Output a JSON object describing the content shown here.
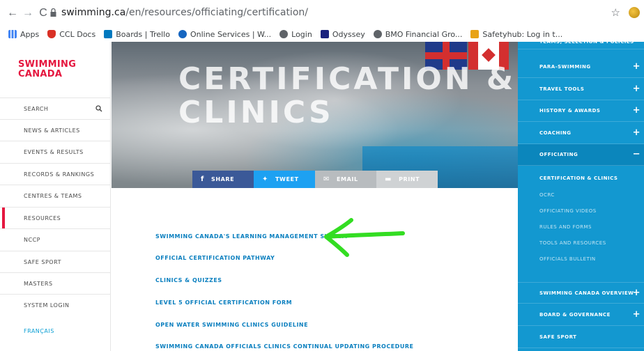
{
  "browser": {
    "url_host": "swimming.ca",
    "url_path": "/en/resources/officiating/certification/",
    "bookmarks": [
      {
        "label": "Apps",
        "icon": "apps-grid-icon",
        "color": "#4285f4"
      },
      {
        "label": "CCL Docs",
        "icon": "ccl-shield-icon",
        "color": "#d93025"
      },
      {
        "label": "Boards | Trello",
        "icon": "trello-icon",
        "color": "#0079bf"
      },
      {
        "label": "Online Services | W...",
        "icon": "online-services-icon",
        "color": "#1565c0"
      },
      {
        "label": "Login",
        "icon": "globe-icon",
        "color": "#5f6368"
      },
      {
        "label": "Odyssey",
        "icon": "odyssey-icon",
        "color": "#1a237e"
      },
      {
        "label": "BMO Financial Gro...",
        "icon": "globe-icon",
        "color": "#5f6368"
      },
      {
        "label": "Safetyhub: Log in t...",
        "icon": "folder-icon",
        "color": "#e8a317"
      }
    ]
  },
  "sidebar": {
    "logo_line1": "SWIMMING",
    "logo_line2": "CANADA",
    "items": [
      {
        "label": "SEARCH"
      },
      {
        "label": "NEWS & ARTICLES"
      },
      {
        "label": "EVENTS & RESULTS"
      },
      {
        "label": "RECORDS & RANKINGS"
      },
      {
        "label": "CENTRES & TEAMS"
      },
      {
        "label": "RESOURCES"
      },
      {
        "label": "NCCP"
      },
      {
        "label": "SAFE SPORT"
      },
      {
        "label": "MASTERS"
      },
      {
        "label": "SYSTEM LOGIN"
      },
      {
        "label": "FRANÇAIS"
      }
    ]
  },
  "hero": {
    "title_line1": "CERTIFICATION &",
    "title_line2": "CLINICS"
  },
  "share": {
    "buttons": [
      {
        "label": "SHARE",
        "icon": "f",
        "color": "#3b5998"
      },
      {
        "label": "TWEET",
        "icon": "t",
        "color": "#1da1f2"
      },
      {
        "label": "EMAIL",
        "icon": "e",
        "color": "#b8bcbf"
      },
      {
        "label": "PRINT",
        "icon": "p",
        "color": "#cfd2d4"
      }
    ]
  },
  "content": {
    "links": [
      "SWIMMING CANADA'S LEARNING MANAGEMENT SYSTEM",
      "OFFICIAL CERTIFICATION PATHWAY",
      "CLINICS & QUIZZES",
      "LEVEL 5 OFFICIAL CERTIFICATION FORM",
      "OPEN WATER SWIMMING CLINICS GUIDELINE",
      "SWIMMING CANADA OFFICIALS CLINICS CONTINUAL UPDATING PROCEDURE"
    ]
  },
  "right_panel": {
    "items": [
      {
        "label": "TEAMS, SELECTION & POLICIES",
        "sign": "+"
      },
      {
        "label": "PARA-SWIMMING",
        "sign": "+"
      },
      {
        "label": "TRAVEL TOOLS",
        "sign": "+"
      },
      {
        "label": "HISTORY & AWARDS",
        "sign": "+"
      },
      {
        "label": "COACHING",
        "sign": "+"
      },
      {
        "label": "OFFICIATING",
        "sign": "−"
      }
    ],
    "sub_items": [
      "CERTIFICATION & CLINICS",
      "OCRC",
      "OFFICIATING VIDEOS",
      "RULES AND FORMS",
      "TOOLS AND RESOURCES",
      "OFFICIALS BULLETIN"
    ],
    "bottom_items": [
      {
        "label": "SWIMMING CANADA OVERVIEW",
        "sign": "+"
      },
      {
        "label": "BOARD & GOVERNANCE",
        "sign": "+"
      },
      {
        "label": "SAFE SPORT",
        "sign": ""
      }
    ]
  },
  "colors": {
    "brand_red": "#e5173f",
    "link_blue": "#0a7fbf",
    "panel_blue": "#1398d0",
    "arrow_green": "#33dd22"
  }
}
